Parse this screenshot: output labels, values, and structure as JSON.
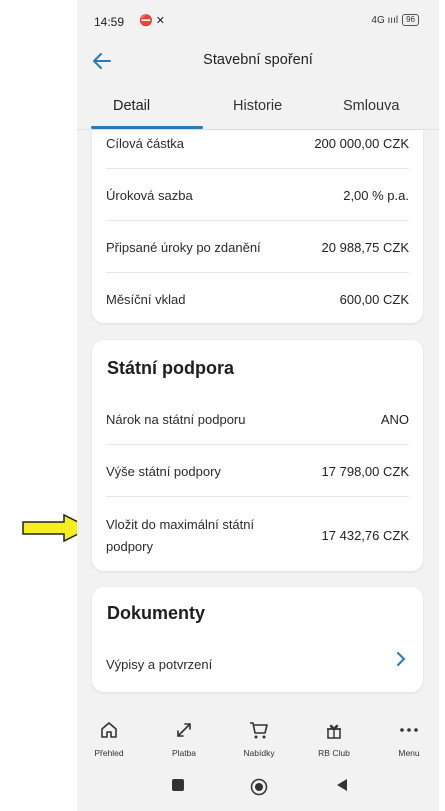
{
  "statusbar": {
    "time": "14:59",
    "icons": "⛔ ✕",
    "signal": "4G ıııl",
    "battery": "96"
  },
  "header": {
    "title": "Stavební spoření"
  },
  "tabs": [
    "Detail",
    "Historie",
    "Smlouva"
  ],
  "account": {
    "rows": [
      {
        "label": "Cílová částka",
        "value": "200 000,00 CZK"
      },
      {
        "label": "Úroková sazba",
        "value": "2,00 % p.a."
      },
      {
        "label": "Připsané úroky po zdanění",
        "value": "20 988,75 CZK"
      },
      {
        "label": "Měsíční vklad",
        "value": "600,00 CZK"
      }
    ]
  },
  "state_support": {
    "title": "Státní podpora",
    "rows": [
      {
        "label": "Nárok na státní podporu",
        "value": "ANO"
      },
      {
        "label": "Výše státní podpory",
        "value": "17 798,00 CZK"
      },
      {
        "label_line1": "Vložit do maximální státní",
        "label_line2": "podpory",
        "value": "17 432,76 CZK"
      }
    ]
  },
  "documents": {
    "title": "Dokumenty",
    "item": "Výpisy a potvrzení"
  },
  "bottom_nav": [
    {
      "label": "Přehled",
      "icon": "home-icon"
    },
    {
      "label": "Platba",
      "icon": "transfer-icon"
    },
    {
      "label": "Nabídky",
      "icon": "cart-icon"
    },
    {
      "label": "RB Club",
      "icon": "gift-icon"
    },
    {
      "label": "Menu",
      "icon": "more-icon"
    }
  ],
  "colors": {
    "accent": "#2779b8",
    "arrow_fill": "#f5ef22"
  }
}
